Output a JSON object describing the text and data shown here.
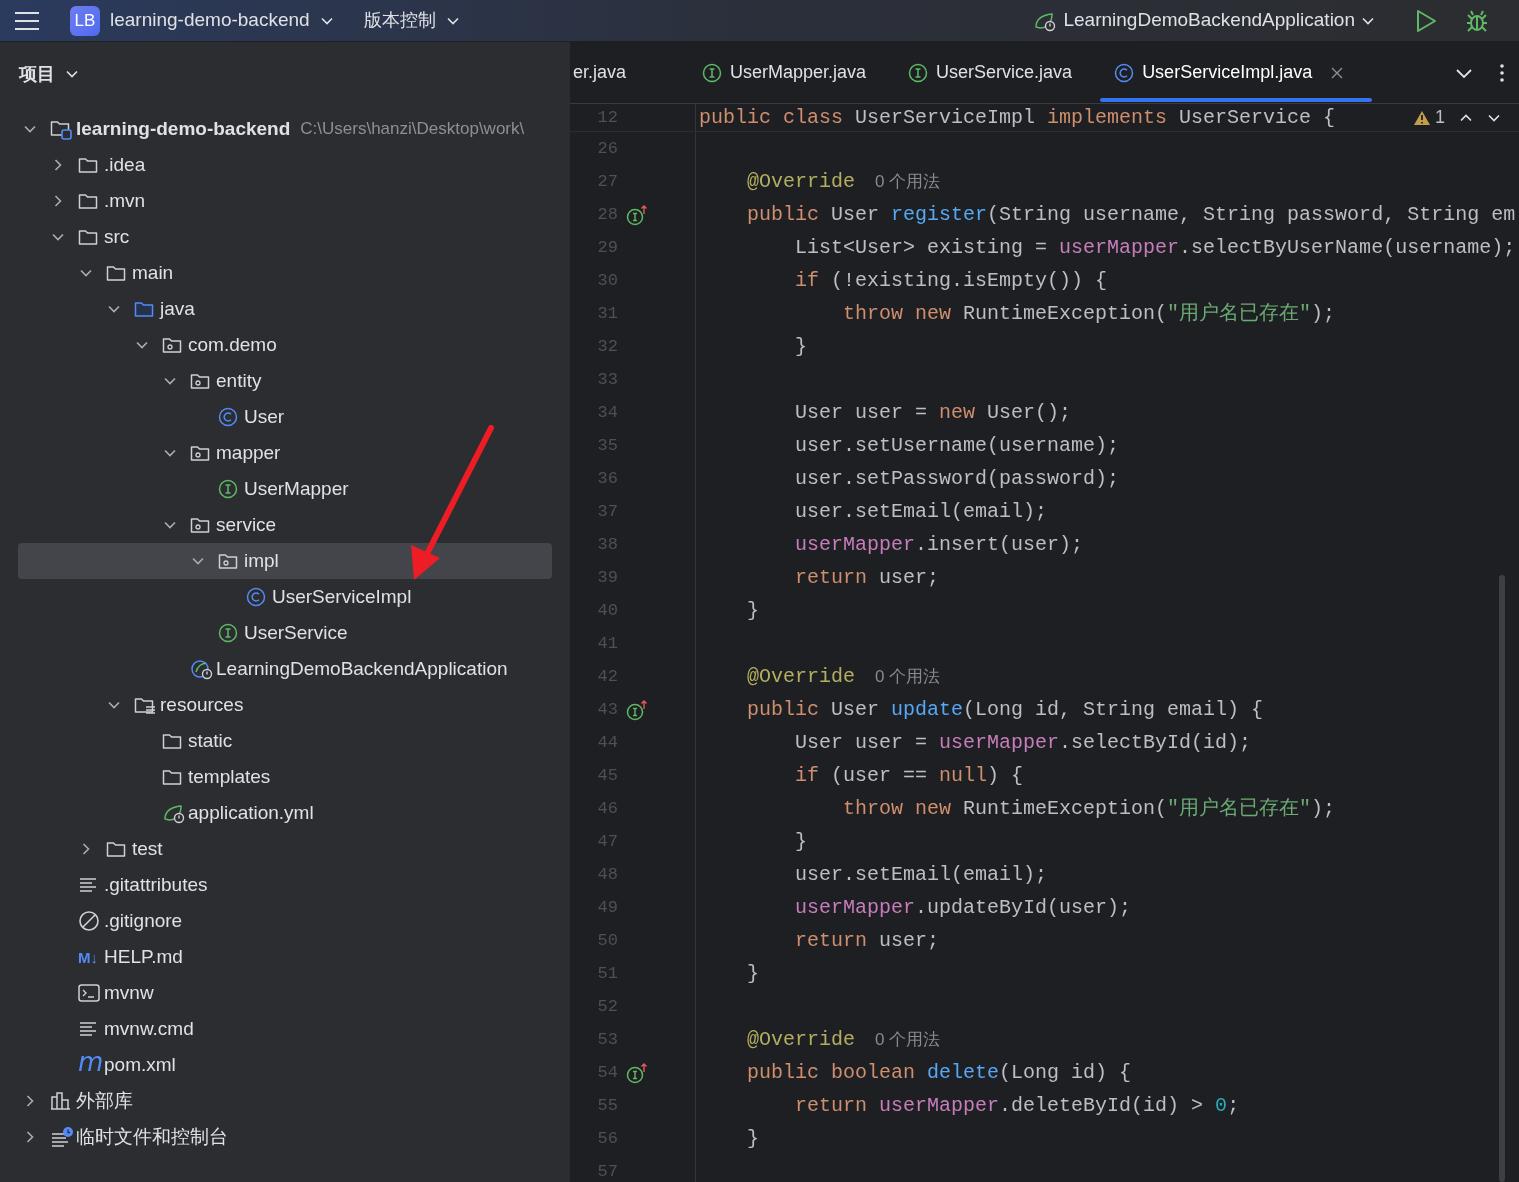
{
  "title_bar": {
    "logo": "LB",
    "project": "learning-demo-backend",
    "vcs": "版本控制",
    "run_config": "LearningDemoBackendApplication"
  },
  "sidebar": {
    "title": "项目",
    "tree": [
      {
        "label": "learning-demo-backend",
        "kind": "project",
        "path": "C:\\Users\\hanzi\\Desktop\\work\\",
        "expanded": true,
        "selected": false,
        "children": [
          {
            "label": ".idea",
            "kind": "folder",
            "expanded": false,
            "selected": false
          },
          {
            "label": ".mvn",
            "kind": "folder",
            "expanded": false,
            "selected": false
          },
          {
            "label": "src",
            "kind": "folder",
            "expanded": true,
            "selected": false,
            "children": [
              {
                "label": "main",
                "kind": "folder",
                "expanded": true,
                "selected": false,
                "children": [
                  {
                    "label": "java",
                    "kind": "source-folder",
                    "expanded": true,
                    "selected": false,
                    "children": [
                      {
                        "label": "com.demo",
                        "kind": "package",
                        "expanded": true,
                        "selected": false,
                        "children": [
                          {
                            "label": "entity",
                            "kind": "package",
                            "expanded": true,
                            "selected": false,
                            "children": [
                              {
                                "label": "User",
                                "kind": "class",
                                "selected": false
                              }
                            ]
                          },
                          {
                            "label": "mapper",
                            "kind": "package",
                            "expanded": true,
                            "selected": false,
                            "children": [
                              {
                                "label": "UserMapper",
                                "kind": "interface",
                                "selected": false
                              }
                            ]
                          },
                          {
                            "label": "service",
                            "kind": "package",
                            "expanded": true,
                            "selected": false,
                            "children": [
                              {
                                "label": "impl",
                                "kind": "package",
                                "expanded": true,
                                "selected": true,
                                "children": [
                                  {
                                    "label": "UserServiceImpl",
                                    "kind": "class",
                                    "selected": false
                                  }
                                ]
                              },
                              {
                                "label": "UserService",
                                "kind": "interface",
                                "selected": false
                              }
                            ]
                          },
                          {
                            "label": "LearningDemoBackendApplication",
                            "kind": "spring-app",
                            "selected": false
                          }
                        ]
                      }
                    ]
                  },
                  {
                    "label": "resources",
                    "kind": "resources",
                    "expanded": true,
                    "selected": false,
                    "children": [
                      {
                        "label": "static",
                        "kind": "folder",
                        "selected": false
                      },
                      {
                        "label": "templates",
                        "kind": "folder",
                        "selected": false
                      },
                      {
                        "label": "application.yml",
                        "kind": "spring-config",
                        "selected": false
                      }
                    ]
                  }
                ]
              },
              {
                "label": "test",
                "kind": "folder",
                "expanded": false,
                "selected": false
              }
            ]
          },
          {
            "label": ".gitattributes",
            "kind": "text",
            "selected": false
          },
          {
            "label": ".gitignore",
            "kind": "ignore",
            "selected": false
          },
          {
            "label": "HELP.md",
            "kind": "markdown",
            "icon_text": "M↓",
            "selected": false
          },
          {
            "label": "mvnw",
            "kind": "shell",
            "selected": false
          },
          {
            "label": "mvnw.cmd",
            "kind": "text",
            "selected": false
          },
          {
            "label": "pom.xml",
            "kind": "maven",
            "icon_text": "m",
            "selected": false
          }
        ]
      },
      {
        "label": "外部库",
        "kind": "libraries",
        "expanded": false,
        "selected": false
      },
      {
        "label": "临时文件和控制台",
        "kind": "scratches",
        "expanded": false,
        "selected": false
      }
    ]
  },
  "editor": {
    "tabs": [
      {
        "label": "er.java",
        "kind": "partial",
        "selected": false
      },
      {
        "label": "UserMapper.java",
        "kind": "interface",
        "selected": false
      },
      {
        "label": "UserService.java",
        "kind": "interface",
        "selected": false
      },
      {
        "label": "UserServiceImpl.java",
        "kind": "class",
        "selected": true
      }
    ],
    "sticky_line": {
      "number": "12",
      "tokens": [
        {
          "kind": "keyword",
          "text": "public class "
        },
        {
          "kind": "plain",
          "text": "UserServiceImpl "
        },
        {
          "kind": "keyword",
          "text": "implements "
        },
        {
          "kind": "plain",
          "text": "UserService {"
        }
      ]
    },
    "warnings": "1",
    "lines": [
      {
        "number": "26",
        "kind": "code"
      },
      {
        "number": "27",
        "kind": "code",
        "tokens": [
          {
            "kind": "annotation",
            "text": "    @Override"
          }
        ],
        "hint": "0 个用法"
      },
      {
        "number": "28",
        "kind": "implementation",
        "tokens": [
          {
            "kind": "keyword",
            "text": "    public "
          },
          {
            "kind": "plain",
            "text": "User "
          },
          {
            "kind": "method",
            "text": "register"
          },
          {
            "kind": "plain",
            "text": "(String username, String password, String em"
          }
        ]
      },
      {
        "number": "29",
        "kind": "code",
        "tokens": [
          {
            "kind": "plain",
            "text": "        List<User> existing = "
          },
          {
            "kind": "field",
            "text": "userMapper"
          },
          {
            "kind": "plain",
            "text": ".selectByUserName(username);"
          }
        ]
      },
      {
        "number": "30",
        "kind": "code",
        "tokens": [
          {
            "kind": "keyword",
            "text": "        if "
          },
          {
            "kind": "plain",
            "text": "(!existing.isEmpty()) {"
          }
        ]
      },
      {
        "number": "31",
        "kind": "code",
        "tokens": [
          {
            "kind": "keyword",
            "text": "            throw new "
          },
          {
            "kind": "plain",
            "text": "RuntimeException("
          },
          {
            "kind": "string",
            "text": "\"用户名已存在\""
          },
          {
            "kind": "plain",
            "text": ");"
          }
        ]
      },
      {
        "number": "32",
        "kind": "code",
        "tokens": [
          {
            "kind": "plain",
            "text": "        }"
          }
        ]
      },
      {
        "number": "33",
        "kind": "code"
      },
      {
        "number": "34",
        "kind": "code",
        "tokens": [
          {
            "kind": "plain",
            "text": "        User user = "
          },
          {
            "kind": "keyword",
            "text": "new "
          },
          {
            "kind": "plain",
            "text": "User();"
          }
        ]
      },
      {
        "number": "35",
        "kind": "code",
        "tokens": [
          {
            "kind": "plain",
            "text": "        user.setUsername(username);"
          }
        ]
      },
      {
        "number": "36",
        "kind": "code",
        "tokens": [
          {
            "kind": "plain",
            "text": "        user.setPassword(password);"
          }
        ]
      },
      {
        "number": "37",
        "kind": "code",
        "tokens": [
          {
            "kind": "plain",
            "text": "        user.setEmail(email);"
          }
        ]
      },
      {
        "number": "38",
        "kind": "code",
        "tokens": [
          {
            "kind": "field",
            "text": "        userMapper"
          },
          {
            "kind": "plain",
            "text": ".insert(user);"
          }
        ]
      },
      {
        "number": "39",
        "kind": "code",
        "tokens": [
          {
            "kind": "keyword",
            "text": "        return "
          },
          {
            "kind": "plain",
            "text": "user;"
          }
        ]
      },
      {
        "number": "40",
        "kind": "code",
        "tokens": [
          {
            "kind": "plain",
            "text": "    }"
          }
        ]
      },
      {
        "number": "41",
        "kind": "code"
      },
      {
        "number": "42",
        "kind": "code",
        "tokens": [
          {
            "kind": "annotation",
            "text": "    @Override"
          }
        ],
        "hint": "0 个用法"
      },
      {
        "number": "43",
        "kind": "implementation",
        "tokens": [
          {
            "kind": "keyword",
            "text": "    public "
          },
          {
            "kind": "plain",
            "text": "User "
          },
          {
            "kind": "method",
            "text": "update"
          },
          {
            "kind": "plain",
            "text": "(Long id, String email) {"
          }
        ]
      },
      {
        "number": "44",
        "kind": "code",
        "tokens": [
          {
            "kind": "plain",
            "text": "        User user = "
          },
          {
            "kind": "field",
            "text": "userMapper"
          },
          {
            "kind": "plain",
            "text": ".selectById(id);"
          }
        ]
      },
      {
        "number": "45",
        "kind": "code",
        "tokens": [
          {
            "kind": "keyword",
            "text": "        if "
          },
          {
            "kind": "plain",
            "text": "(user == "
          },
          {
            "kind": "keyword",
            "text": "null"
          },
          {
            "kind": "plain",
            "text": ") {"
          }
        ]
      },
      {
        "number": "46",
        "kind": "code",
        "tokens": [
          {
            "kind": "keyword",
            "text": "            throw new "
          },
          {
            "kind": "plain",
            "text": "RuntimeException("
          },
          {
            "kind": "string",
            "text": "\"用户名已存在\""
          },
          {
            "kind": "plain",
            "text": ");"
          }
        ]
      },
      {
        "number": "47",
        "kind": "code",
        "tokens": [
          {
            "kind": "plain",
            "text": "        }"
          }
        ]
      },
      {
        "number": "48",
        "kind": "code",
        "tokens": [
          {
            "kind": "plain",
            "text": "        user.setEmail(email);"
          }
        ]
      },
      {
        "number": "49",
        "kind": "code",
        "tokens": [
          {
            "kind": "field",
            "text": "        userMapper"
          },
          {
            "kind": "plain",
            "text": ".updateById(user);"
          }
        ]
      },
      {
        "number": "50",
        "kind": "code",
        "tokens": [
          {
            "kind": "keyword",
            "text": "        return "
          },
          {
            "kind": "plain",
            "text": "user;"
          }
        ]
      },
      {
        "number": "51",
        "kind": "code",
        "tokens": [
          {
            "kind": "plain",
            "text": "    }"
          }
        ]
      },
      {
        "number": "52",
        "kind": "code"
      },
      {
        "number": "53",
        "kind": "code",
        "tokens": [
          {
            "kind": "annotation",
            "text": "    @Override"
          }
        ],
        "hint": "0 个用法"
      },
      {
        "number": "54",
        "kind": "implementation",
        "tokens": [
          {
            "kind": "keyword",
            "text": "    public boolean "
          },
          {
            "kind": "method",
            "text": "delete"
          },
          {
            "kind": "plain",
            "text": "(Long id) {"
          }
        ]
      },
      {
        "number": "55",
        "kind": "code",
        "tokens": [
          {
            "kind": "keyword",
            "text": "        return "
          },
          {
            "kind": "field",
            "text": "userMapper"
          },
          {
            "kind": "plain",
            "text": ".deleteById(id) > "
          },
          {
            "kind": "number",
            "text": "0"
          },
          {
            "kind": "plain",
            "text": ";"
          }
        ]
      },
      {
        "number": "56",
        "kind": "code",
        "tokens": [
          {
            "kind": "plain",
            "text": "    }"
          }
        ]
      },
      {
        "number": "57",
        "kind": "code"
      }
    ]
  }
}
